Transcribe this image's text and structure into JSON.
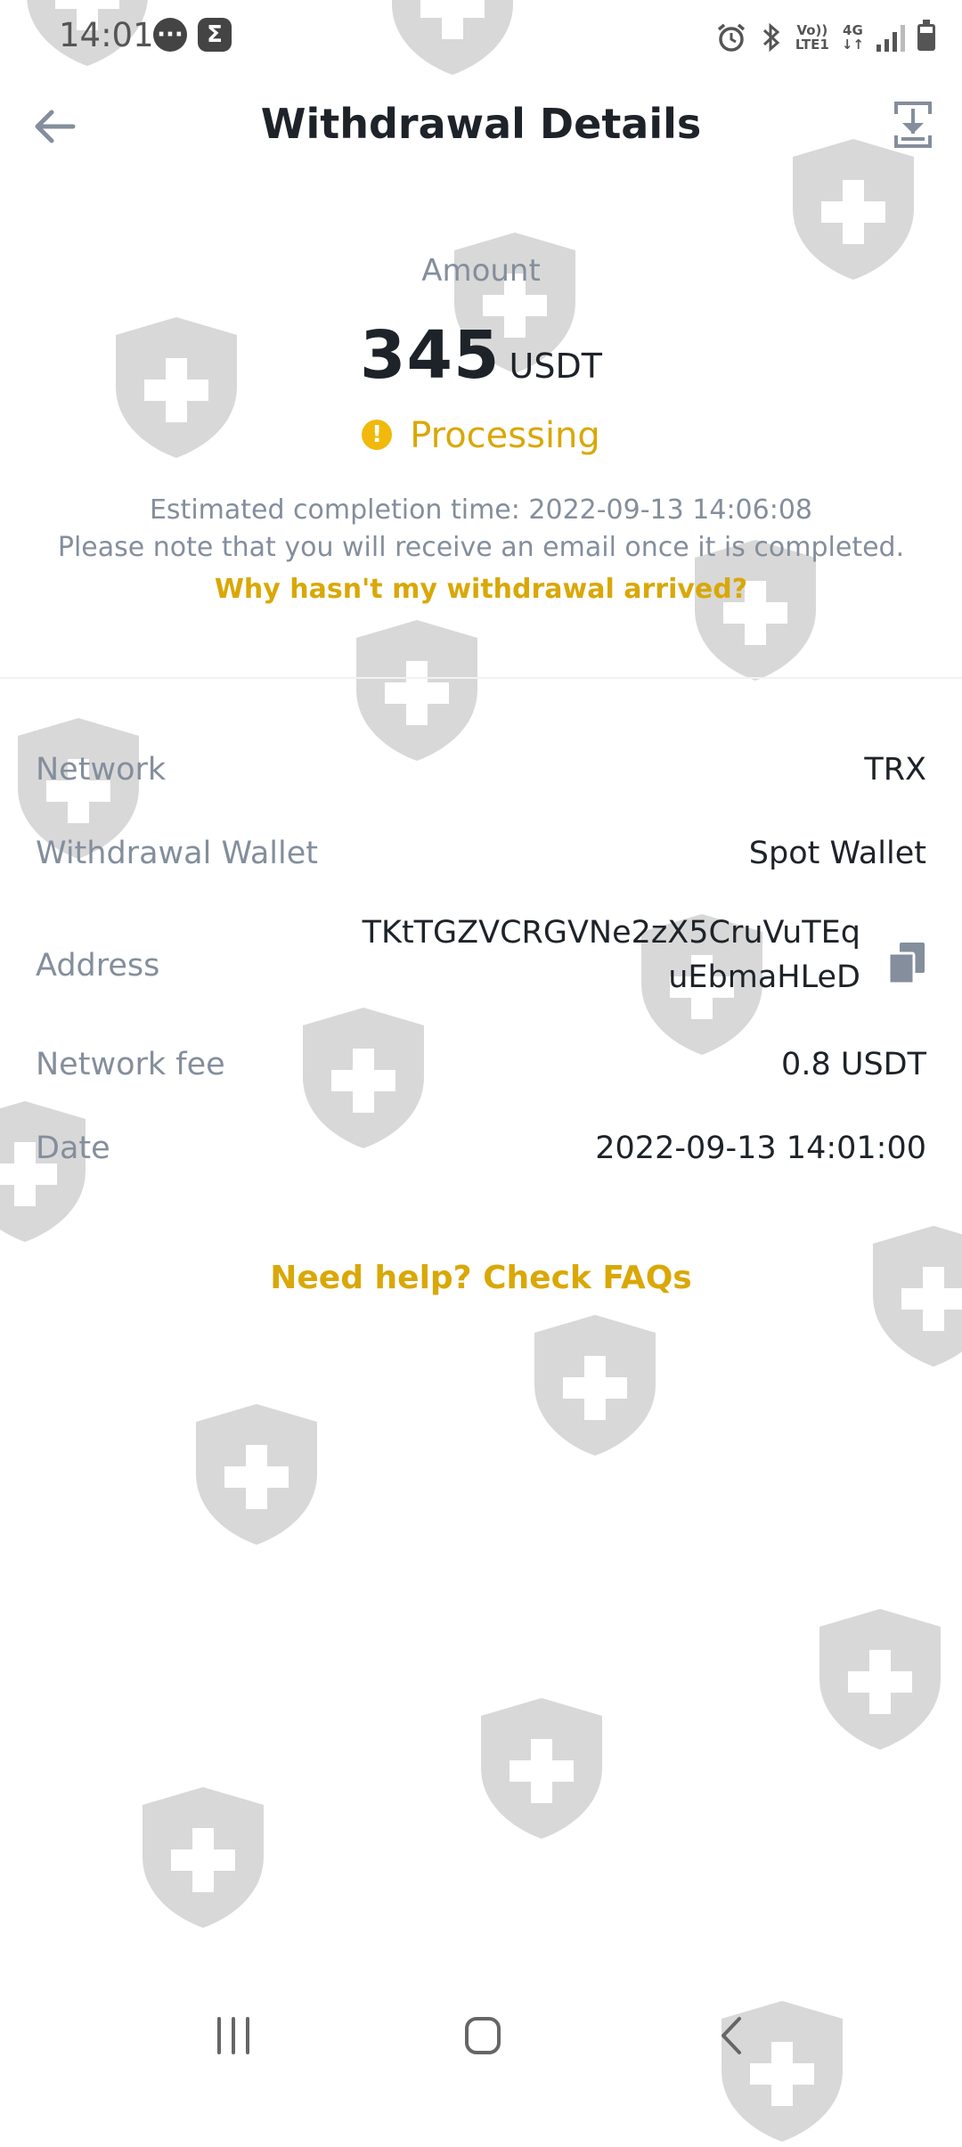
{
  "status_bar": {
    "time": "14:01",
    "notif_icons": [
      "chat-bubble-icon",
      "sigma-icon"
    ],
    "icons": [
      "alarm-icon",
      "bluetooth-icon",
      "volte-icon",
      "4g-icon",
      "signal-icon",
      "battery-icon"
    ],
    "volte_label_top": "Vo))",
    "volte_label_bottom": "LTE1",
    "network_label": "4G"
  },
  "header": {
    "title": "Withdrawal Details",
    "back_icon": "arrow-left-icon",
    "download_icon": "download-icon"
  },
  "summary": {
    "amount_label": "Amount",
    "amount_value": "345",
    "amount_unit": "USDT",
    "status_icon": "!",
    "status_text": "Processing",
    "eta_text": "Estimated completion time: 2022-09-13 14:06:08",
    "note_text": "Please note that you will receive an email once it is completed.",
    "why_link": "Why hasn't my withdrawal arrived?"
  },
  "details": {
    "network_label": "Network",
    "network_value": "TRX",
    "wallet_label": "Withdrawal Wallet",
    "wallet_value": "Spot Wallet",
    "address_label": "Address",
    "address_value": "TKtTGZVCRGVNe2zX5CruVuTEquEbmaHLeD",
    "fee_label": "Network fee",
    "fee_value": "0.8 USDT",
    "date_label": "Date",
    "date_value": "2022-09-13 14:01:00"
  },
  "faq_link": "Need help? Check FAQs",
  "colors": {
    "accent": "#f0b90b",
    "accent_text": "#d9a807",
    "muted": "#848e9c",
    "text": "#1e2329"
  }
}
